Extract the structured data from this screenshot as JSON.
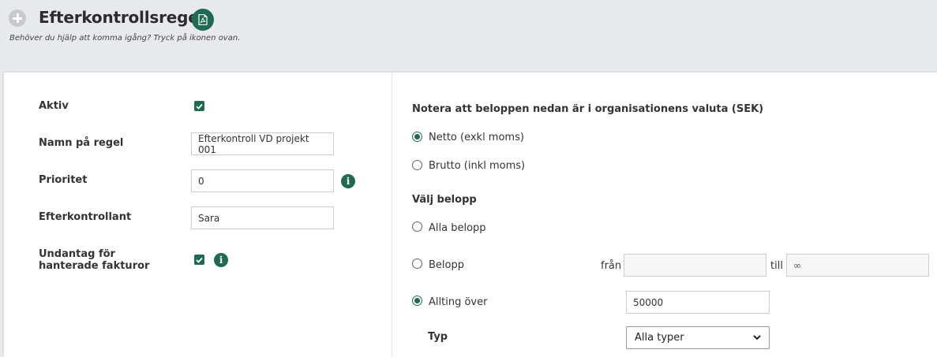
{
  "header": {
    "title": "Efterkontrollsregel",
    "help_text": "Behöver du hjälp att komma igång? Tryck på ikonen ovan."
  },
  "form": {
    "active_label": "Aktiv",
    "active_checked": true,
    "name_label": "Namn på regel",
    "name_value": "Efterkontroll VD projekt 001",
    "priority_label": "Prioritet",
    "priority_value": "0",
    "controller_label": "Efterkontrollant",
    "controller_value": "Sara",
    "exception_label": "Undantag för hanterade fakturor",
    "exception_checked": true
  },
  "amounts": {
    "note": "Notera att beloppen nedan är i organisationens valuta (SEK)",
    "net_label": "Netto (exkl moms)",
    "gross_label": "Brutto (inkl moms)",
    "selected_tax_mode": "net",
    "choose_heading": "Välj belopp",
    "all_label": "Alla belopp",
    "range_label": "Belopp",
    "from_label": "från",
    "from_value": "",
    "to_label": "till",
    "to_placeholder": "∞",
    "above_label": "Allting över",
    "above_value": "50000",
    "selected_amount_mode": "above",
    "type_label": "Typ",
    "type_selected": "Alla typer"
  },
  "colors": {
    "accent": "#1f6b52",
    "header_bg": "#e8e9ec"
  }
}
